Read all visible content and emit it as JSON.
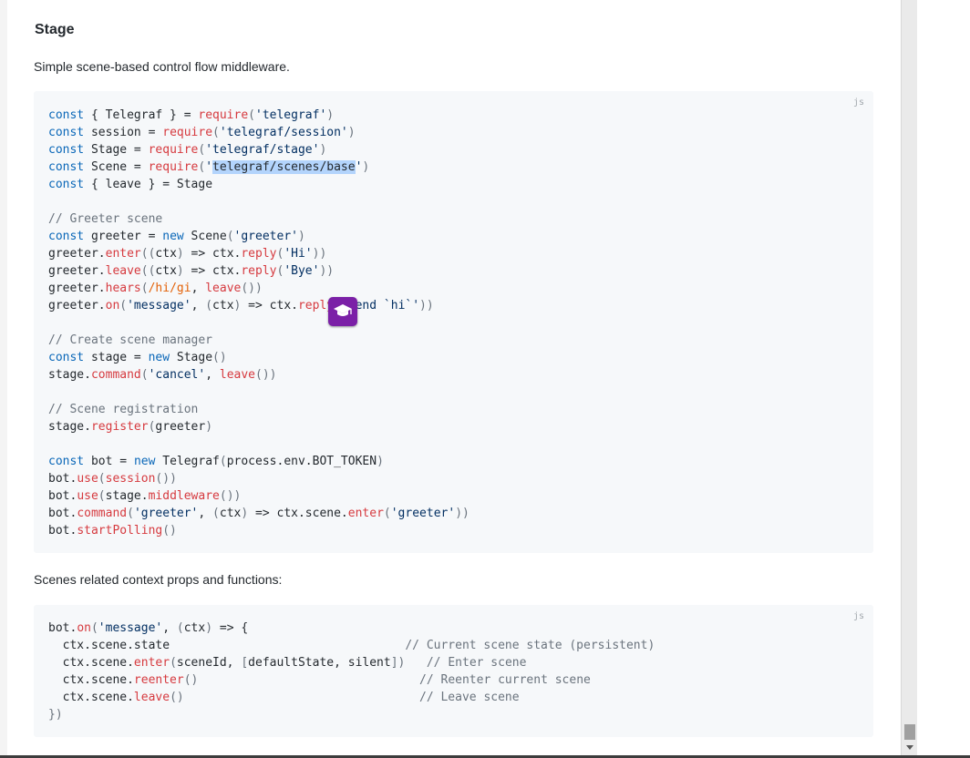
{
  "section": {
    "title": "Stage",
    "description": "Simple scene-based control flow middleware.",
    "context_description": "Scenes related context props and functions:"
  },
  "code_block_1": {
    "language": "js",
    "lines": [
      [
        [
          "k",
          "const"
        ],
        [
          "",
          "{ Telegraf } = "
        ],
        [
          "f",
          "require"
        ],
        [
          "p",
          "("
        ],
        [
          "s",
          "'telegraf'"
        ],
        [
          "p",
          ")"
        ]
      ],
      [
        [
          "k",
          "const"
        ],
        [
          "",
          "session = "
        ],
        [
          "f",
          "require"
        ],
        [
          "p",
          "("
        ],
        [
          "s",
          "'telegraf/session'"
        ],
        [
          "p",
          ")"
        ]
      ],
      [
        [
          "k",
          "const"
        ],
        [
          "",
          "Stage = "
        ],
        [
          "f",
          "require"
        ],
        [
          "p",
          "("
        ],
        [
          "s",
          "'telegraf/stage'"
        ],
        [
          "p",
          ")"
        ]
      ],
      [
        [
          "k",
          "const"
        ],
        [
          "",
          "Scene = "
        ],
        [
          "f",
          "require"
        ],
        [
          "p",
          "("
        ],
        [
          "s",
          "'"
        ],
        [
          "sel",
          "telegraf/scenes/base"
        ],
        [
          "s",
          "'"
        ],
        [
          "p",
          ")"
        ]
      ],
      [
        [
          "k",
          "const"
        ],
        [
          "",
          "{ leave } = Stage"
        ]
      ],
      [],
      [
        [
          "c",
          "// Greeter scene"
        ]
      ],
      [
        [
          "k",
          "const"
        ],
        [
          "",
          "greeter = "
        ],
        [
          "k",
          "new"
        ],
        [
          "",
          " Scene"
        ],
        [
          "p",
          "("
        ],
        [
          "s",
          "'greeter'"
        ],
        [
          "p",
          ")"
        ]
      ],
      [
        [
          "",
          "greeter."
        ],
        [
          "f",
          "enter"
        ],
        [
          "p",
          "(("
        ],
        [
          "",
          "ctx"
        ],
        [
          "p",
          ")"
        ],
        [
          "",
          " => ctx."
        ],
        [
          "f",
          "reply"
        ],
        [
          "p",
          "("
        ],
        [
          "s",
          "'Hi'"
        ],
        [
          "p",
          "))"
        ]
      ],
      [
        [
          "",
          "greeter."
        ],
        [
          "f",
          "leave"
        ],
        [
          "p",
          "(("
        ],
        [
          "",
          "ctx"
        ],
        [
          "p",
          ")"
        ],
        [
          "",
          " => ctx."
        ],
        [
          "f",
          "reply"
        ],
        [
          "p",
          "("
        ],
        [
          "s",
          "'Bye'"
        ],
        [
          "p",
          "))"
        ]
      ],
      [
        [
          "",
          "greeter."
        ],
        [
          "f",
          "hears"
        ],
        [
          "p",
          "("
        ],
        [
          "r",
          "/hi/gi"
        ],
        [
          "",
          ", "
        ],
        [
          "f",
          "leave"
        ],
        [
          "p",
          "())"
        ]
      ],
      [
        [
          "",
          "greeter."
        ],
        [
          "f",
          "on"
        ],
        [
          "p",
          "("
        ],
        [
          "s",
          "'message'"
        ],
        [
          "",
          ", "
        ],
        [
          "p",
          "("
        ],
        [
          "",
          "ctx"
        ],
        [
          "p",
          ")"
        ],
        [
          "",
          " => ctx."
        ],
        [
          "f",
          "reply"
        ],
        [
          "p",
          "("
        ],
        [
          "s",
          "'Send `hi`'"
        ],
        [
          "p",
          "))"
        ]
      ],
      [],
      [
        [
          "c",
          "// Create scene manager"
        ]
      ],
      [
        [
          "k",
          "const"
        ],
        [
          "",
          "stage = "
        ],
        [
          "k",
          "new"
        ],
        [
          "",
          " Stage"
        ],
        [
          "p",
          "()"
        ]
      ],
      [
        [
          "",
          "stage."
        ],
        [
          "f",
          "command"
        ],
        [
          "p",
          "("
        ],
        [
          "s",
          "'cancel'"
        ],
        [
          "",
          ", "
        ],
        [
          "f",
          "leave"
        ],
        [
          "p",
          "())"
        ]
      ],
      [],
      [
        [
          "c",
          "// Scene registration"
        ]
      ],
      [
        [
          "",
          "stage."
        ],
        [
          "f",
          "register"
        ],
        [
          "p",
          "("
        ],
        [
          "",
          "greeter"
        ],
        [
          "p",
          ")"
        ]
      ],
      [],
      [
        [
          "k",
          "const"
        ],
        [
          "",
          "bot = "
        ],
        [
          "k",
          "new"
        ],
        [
          "",
          " Telegraf"
        ],
        [
          "p",
          "("
        ],
        [
          "",
          "process.env.BOT_TOKEN"
        ],
        [
          "p",
          ")"
        ]
      ],
      [
        [
          "",
          "bot."
        ],
        [
          "f",
          "use"
        ],
        [
          "p",
          "("
        ],
        [
          "f",
          "session"
        ],
        [
          "p",
          "())"
        ]
      ],
      [
        [
          "",
          "bot."
        ],
        [
          "f",
          "use"
        ],
        [
          "p",
          "("
        ],
        [
          "",
          "stage."
        ],
        [
          "f",
          "middleware"
        ],
        [
          "p",
          "())"
        ]
      ],
      [
        [
          "",
          "bot."
        ],
        [
          "f",
          "command"
        ],
        [
          "p",
          "("
        ],
        [
          "s",
          "'greeter'"
        ],
        [
          "",
          ", "
        ],
        [
          "p",
          "("
        ],
        [
          "",
          "ctx"
        ],
        [
          "p",
          ")"
        ],
        [
          "",
          " => ctx.scene."
        ],
        [
          "f",
          "enter"
        ],
        [
          "p",
          "("
        ],
        [
          "s",
          "'greeter'"
        ],
        [
          "p",
          "))"
        ]
      ],
      [
        [
          "",
          "bot."
        ],
        [
          "f",
          "startPolling"
        ],
        [
          "p",
          "()"
        ]
      ]
    ]
  },
  "code_block_2": {
    "language": "js",
    "lines": [
      [
        [
          "",
          "bot."
        ],
        [
          "f",
          "on"
        ],
        [
          "p",
          "("
        ],
        [
          "s",
          "'message'"
        ],
        [
          "",
          ", "
        ],
        [
          "p",
          "("
        ],
        [
          "",
          "ctx"
        ],
        [
          "p",
          ")"
        ],
        [
          "",
          " => {"
        ]
      ],
      [
        [
          "",
          "  ctx.scene.state                                 "
        ],
        [
          "c",
          "// Current scene state (persistent)"
        ]
      ],
      [
        [
          "",
          "  ctx.scene."
        ],
        [
          "f",
          "enter"
        ],
        [
          "p",
          "("
        ],
        [
          "",
          "sceneId, "
        ],
        [
          "p",
          "["
        ],
        [
          "",
          "defaultState, silent"
        ],
        [
          "p",
          "])"
        ],
        [
          "",
          "   "
        ],
        [
          "c",
          "// Enter scene"
        ]
      ],
      [
        [
          "",
          "  ctx.scene."
        ],
        [
          "f",
          "reenter"
        ],
        [
          "p",
          "()"
        ],
        [
          "",
          "                               "
        ],
        [
          "c",
          "// Reenter current scene"
        ]
      ],
      [
        [
          "",
          "  ctx.scene."
        ],
        [
          "f",
          "leave"
        ],
        [
          "p",
          "()"
        ],
        [
          "",
          "                                 "
        ],
        [
          "c",
          "// Leave scene"
        ]
      ],
      [
        [
          "p",
          "})"
        ]
      ]
    ]
  },
  "overlay": {
    "icon": "graduation-cap-icon",
    "color": "#7b20a7"
  }
}
